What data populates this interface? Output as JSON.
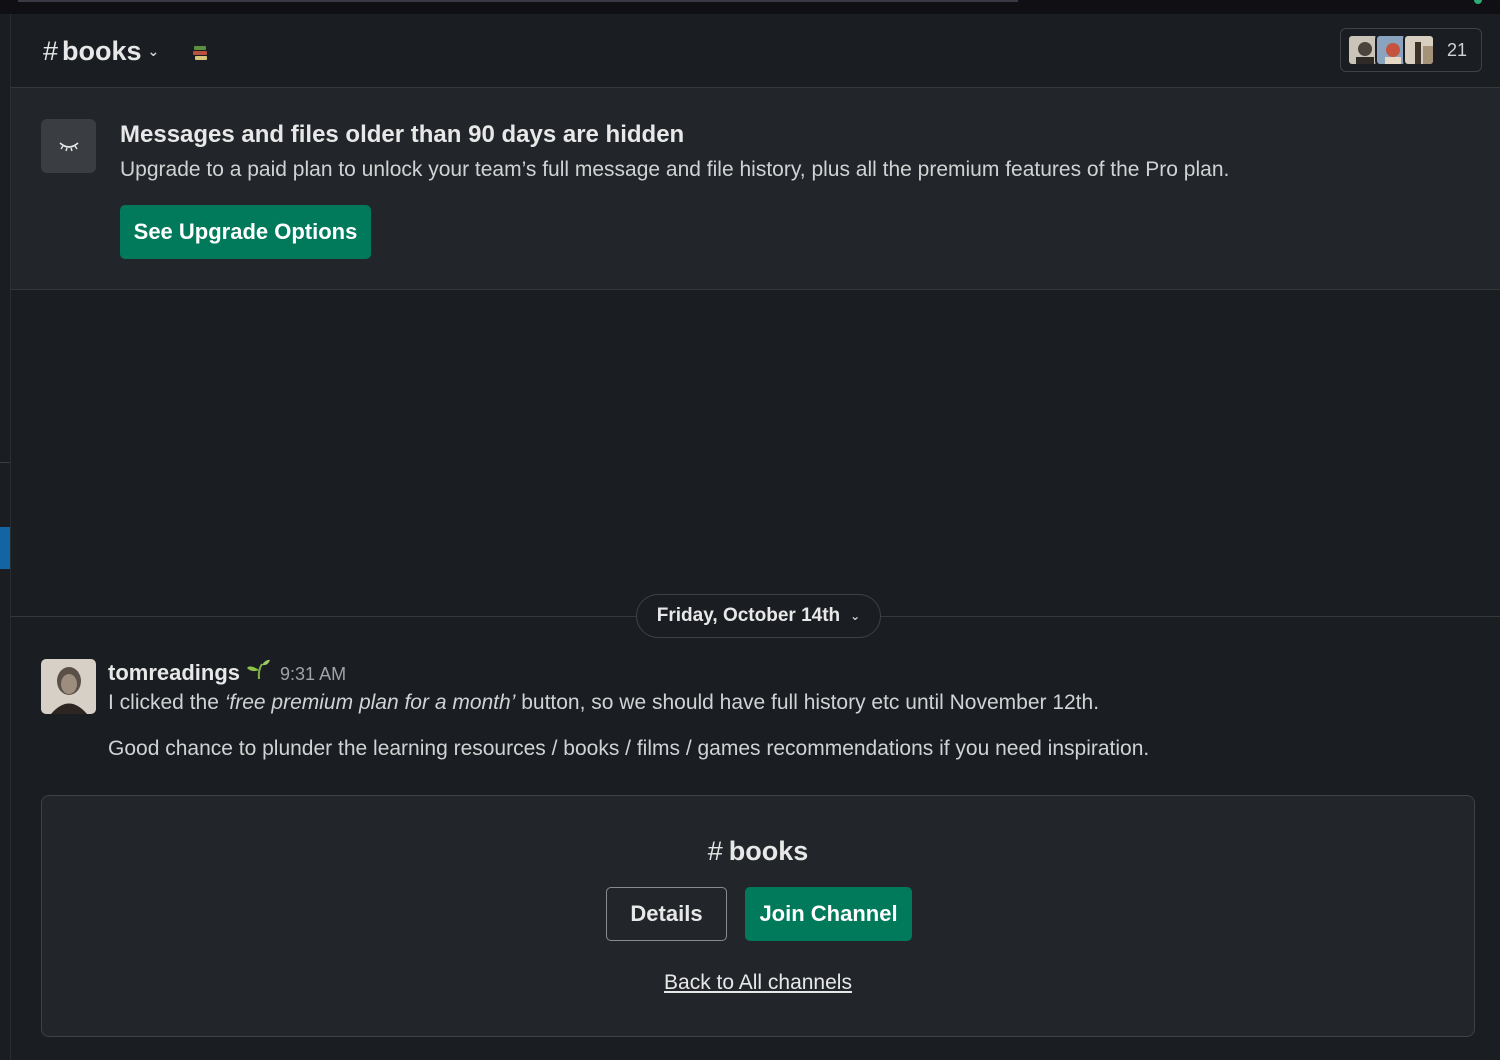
{
  "header": {
    "hash": "#",
    "channel_name": "books",
    "member_count": "21"
  },
  "banner": {
    "title": "Messages and files older than 90 days are hidden",
    "text": "Upgrade to a paid plan to unlock your team’s full message and file history, plus all the premium features of the Pro plan.",
    "button_label": "See Upgrade Options"
  },
  "date_divider": {
    "label": "Friday, October 14th"
  },
  "message": {
    "author": "tomreadings",
    "time": "9:31 AM",
    "line1_before": "I clicked the ",
    "line1_italic": "‘free premium plan for a month’",
    "line1_after": " button, so we should have full history etc until November 12th.",
    "line2": "Good chance to plunder the learning resources / books / films / games recommendations if you need inspiration."
  },
  "join_card": {
    "hash": "#",
    "channel_name": "books",
    "details_label": "Details",
    "join_label": "Join Channel",
    "back_label": "Back to All channels"
  },
  "colors": {
    "background": "#1a1d21",
    "panel": "#222529",
    "accent_green": "#007a5a",
    "selection_blue": "#1264a3"
  },
  "icons": [
    "chevron-down-icon",
    "books-emoji-icon",
    "eye-closed-icon",
    "seedling-emoji-icon",
    "avatar"
  ]
}
